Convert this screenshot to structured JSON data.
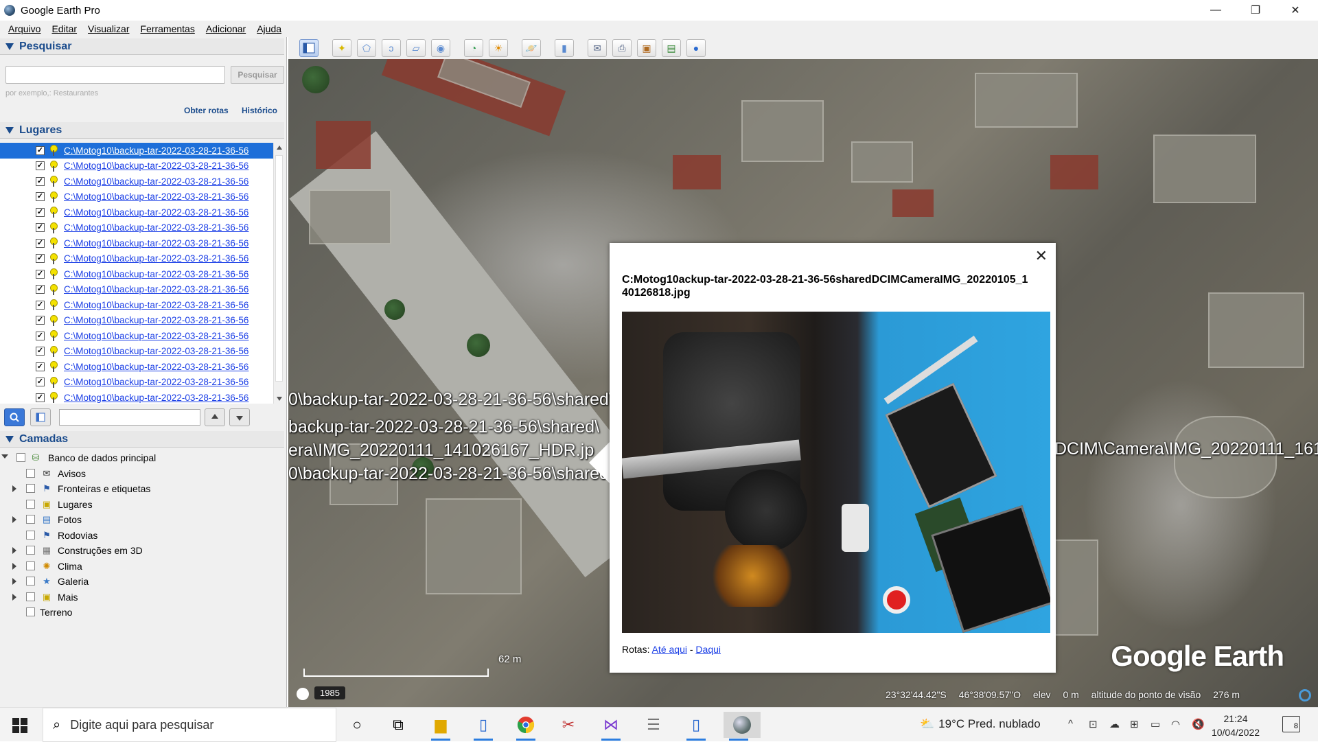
{
  "window": {
    "title": "Google Earth Pro",
    "controls": {
      "minimize": "—",
      "maximize": "❐",
      "close": "✕"
    }
  },
  "menu": [
    {
      "label": "Arquivo"
    },
    {
      "label": "Editar"
    },
    {
      "label": "Visualizar"
    },
    {
      "label": "Ferramentas"
    },
    {
      "label": "Adicionar"
    },
    {
      "label": "Ajuda"
    }
  ],
  "search": {
    "heading": "Pesquisar",
    "input_value": "",
    "button": "Pesquisar",
    "hint": "por exemplo,: Restaurantes",
    "routes_link": "Obter rotas",
    "history_link": "Histórico"
  },
  "places": {
    "heading": "Lugares",
    "items": [
      "C:\\Motog10\\backup-tar-2022-03-28-21-36-56",
      "C:\\Motog10\\backup-tar-2022-03-28-21-36-56",
      "C:\\Motog10\\backup-tar-2022-03-28-21-36-56",
      "C:\\Motog10\\backup-tar-2022-03-28-21-36-56",
      "C:\\Motog10\\backup-tar-2022-03-28-21-36-56",
      "C:\\Motog10\\backup-tar-2022-03-28-21-36-56",
      "C:\\Motog10\\backup-tar-2022-03-28-21-36-56",
      "C:\\Motog10\\backup-tar-2022-03-28-21-36-56",
      "C:\\Motog10\\backup-tar-2022-03-28-21-36-56",
      "C:\\Motog10\\backup-tar-2022-03-28-21-36-56",
      "C:\\Motog10\\backup-tar-2022-03-28-21-36-56",
      "C:\\Motog10\\backup-tar-2022-03-28-21-36-56",
      "C:\\Motog10\\backup-tar-2022-03-28-21-36-56",
      "C:\\Motog10\\backup-tar-2022-03-28-21-36-56",
      "C:\\Motog10\\backup-tar-2022-03-28-21-36-56",
      "C:\\Motog10\\backup-tar-2022-03-28-21-36-56",
      "C:\\Motog10\\backup-tar-2022-03-28-21-36-56"
    ],
    "selected_index": 0,
    "filter_value": ""
  },
  "layers": {
    "heading": "Camadas",
    "items": [
      {
        "label": "Banco de dados principal",
        "icon": "database-icon"
      },
      {
        "label": "Avisos",
        "icon": "envelope-icon"
      },
      {
        "label": "Fronteiras e etiquetas",
        "icon": "flag-icon"
      },
      {
        "label": "Lugares",
        "icon": "square-icon"
      },
      {
        "label": "Fotos",
        "icon": "photo-icon"
      },
      {
        "label": "Rodovias",
        "icon": "flag-icon"
      },
      {
        "label": "Construções em 3D",
        "icon": "building-icon"
      },
      {
        "label": "Clima",
        "icon": "sun-icon"
      },
      {
        "label": "Galeria",
        "icon": "star-icon"
      },
      {
        "label": "Mais",
        "icon": "square-icon"
      },
      {
        "label": "Terreno",
        "icon": ""
      }
    ]
  },
  "map": {
    "labels": [
      "0\\backup-tar-2022-03-28-21-36-56\\shared\\",
      "backup-tar-2022-03-28-21-36-56\\shared\\",
      "era\\IMG_20220111_141026167_HDR.jp",
      "0\\backup-tar-2022-03-28-21-36-56\\shared",
      "DCIM\\Camera\\IMG_20220111_161"
    ],
    "logo": "Google Earth",
    "scale": "62 m",
    "year": "1985",
    "status": {
      "lat": "23°32'44.42\"S",
      "lon": "46°38'09.57\"O",
      "elev_label": "elev",
      "elev": "0 m",
      "eye_label": "altitude do ponto de visão",
      "eye": "276 m"
    }
  },
  "balloon": {
    "title": "C:Motog10ackup-tar-2022-03-28-21-36-56sharedDCIMCameraIMG_20220105_140126818.jpg",
    "routes_label": "Rotas:",
    "to_here": "Até aqui",
    "separator": "-",
    "from_here": "Daqui",
    "close": "✕"
  },
  "taskbar": {
    "search_placeholder": "Digite aqui para pesquisar",
    "weather": "19°C  Pred. nublado",
    "time": "21:24",
    "date": "10/04/2022",
    "notifications": "8"
  }
}
